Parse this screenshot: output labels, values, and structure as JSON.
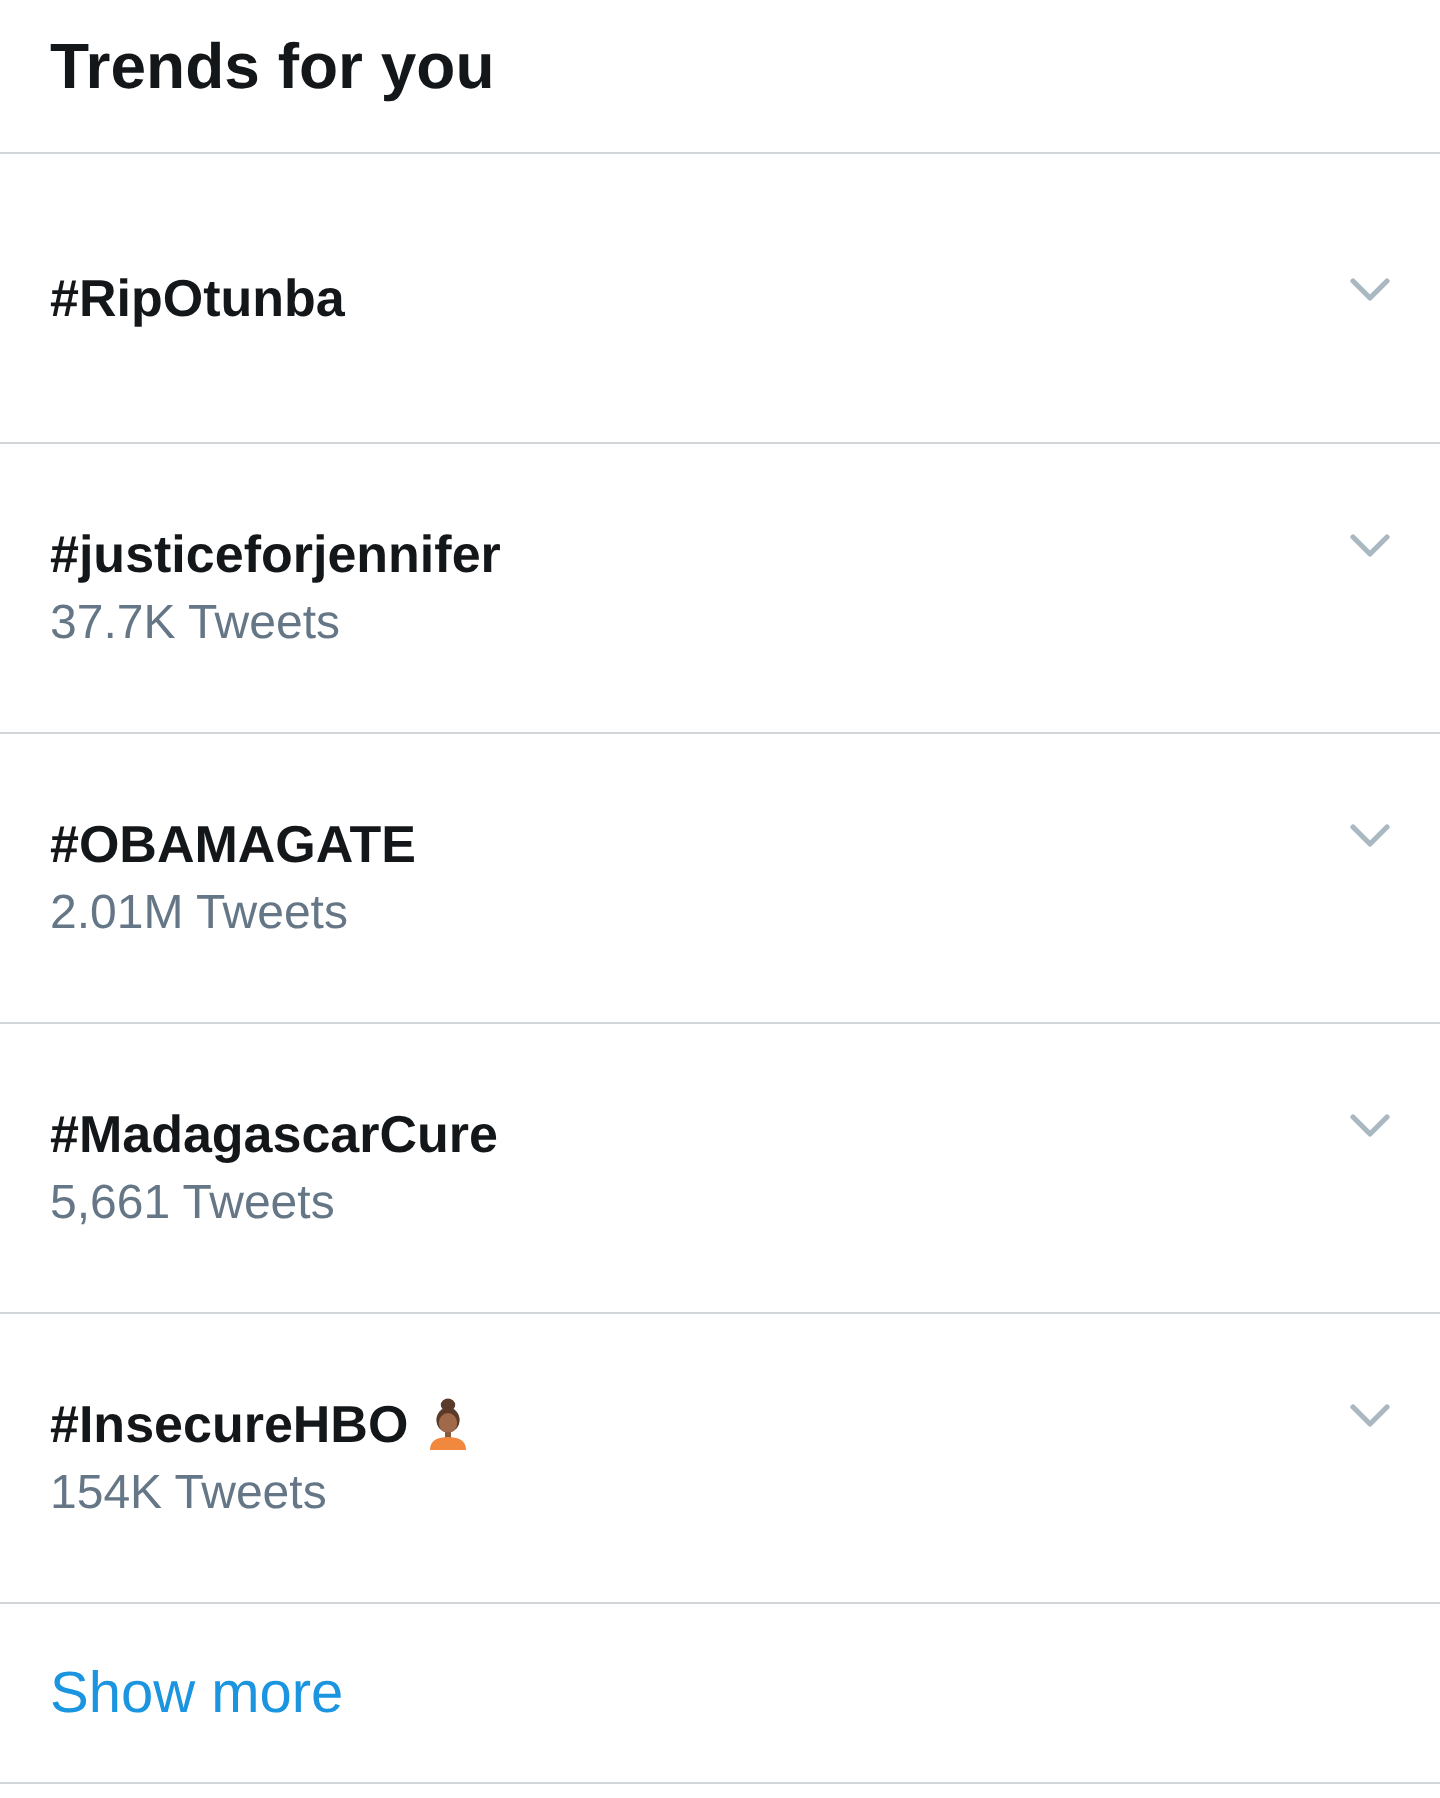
{
  "header": {
    "title": "Trends for you"
  },
  "trends": [
    {
      "name": "#RipOtunba",
      "kind": "plain"
    },
    {
      "name": "#justiceforjennifer",
      "kind": "plain",
      "count": "37.7K Tweets"
    },
    {
      "name": "#OBAMAGATE",
      "kind": "plain",
      "count": "2.01M Tweets"
    },
    {
      "name": "#MadagascarCure",
      "kind": "plain",
      "count": "5,661 Tweets"
    },
    {
      "name": "#InsecureHBO",
      "kind": "emoji",
      "count": "154K Tweets"
    }
  ],
  "show_more": {
    "label": "Show more"
  }
}
